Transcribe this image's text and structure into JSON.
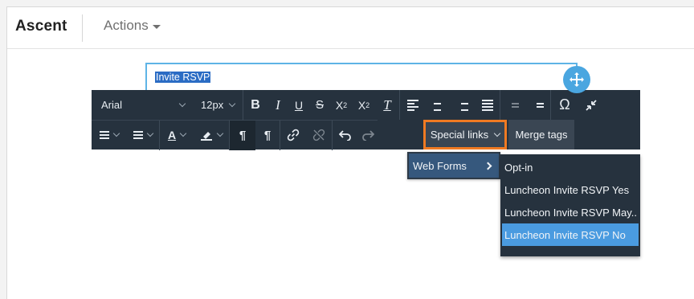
{
  "header": {
    "brand": "Ascent",
    "actions_label": "Actions"
  },
  "editor": {
    "selected_text": "Invite RSVP"
  },
  "toolbar": {
    "font_family": "Arial",
    "font_size": "12px",
    "bold": "B",
    "italic": "I",
    "underline": "U",
    "strikethrough": "S",
    "superscript": "X",
    "subscript": "X",
    "clear_format": "T",
    "special_chars": "Ω",
    "special_links_label": "Special links",
    "merge_tags_label": "Merge tags"
  },
  "submenu": {
    "items": [
      {
        "label": "Web Forms"
      }
    ]
  },
  "flyout": {
    "items": [
      {
        "label": "Opt-in"
      },
      {
        "label": "Luncheon Invite RSVP Yes"
      },
      {
        "label": "Luncheon Invite RSVP May..."
      },
      {
        "label": "Luncheon Invite RSVP No",
        "active": true
      }
    ]
  },
  "colors": {
    "toolbar_bg": "#26323e",
    "highlight_border": "#f07a22",
    "active_item": "#4a9be0",
    "move_handle": "#4aa6e0"
  }
}
